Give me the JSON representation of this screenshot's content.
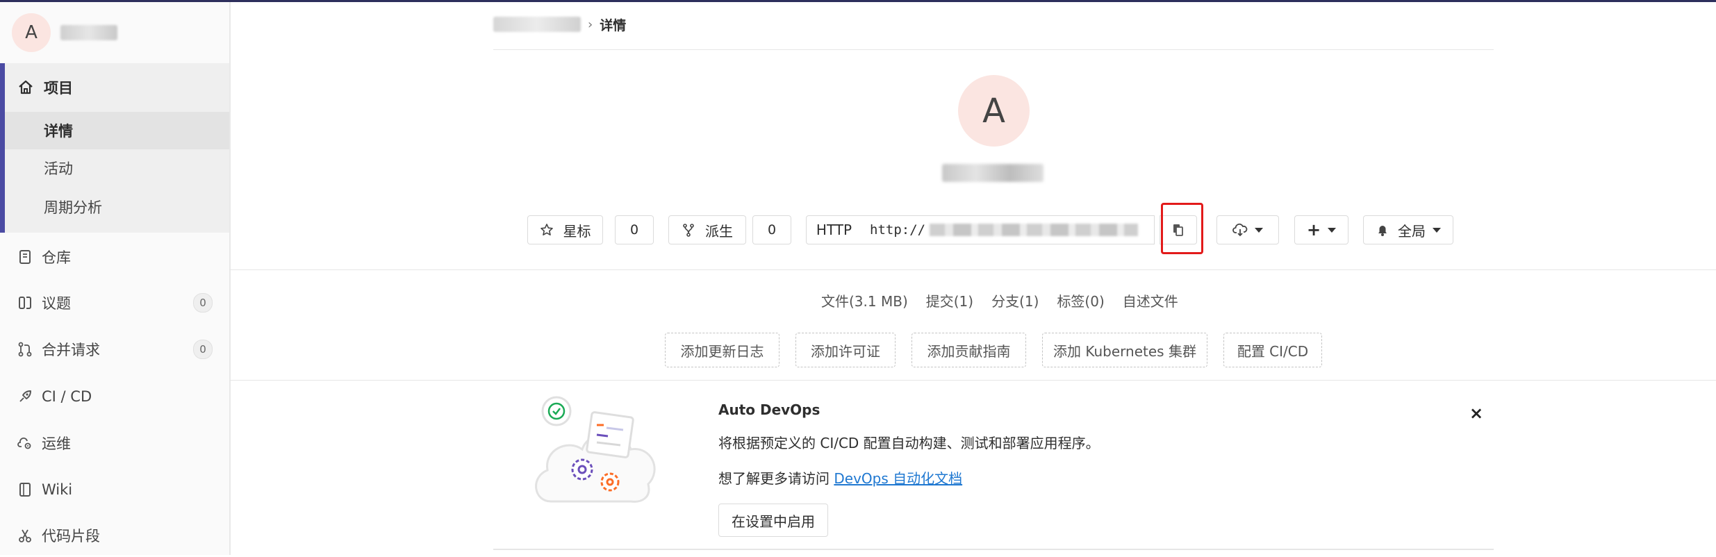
{
  "sidebar": {
    "project_avatar_letter": "A",
    "project_section": {
      "label": "项目",
      "items": [
        {
          "label": "详情",
          "active": true
        },
        {
          "label": "活动"
        },
        {
          "label": "周期分析"
        }
      ]
    },
    "nav": [
      {
        "label": "仓库",
        "icon": "book-icon"
      },
      {
        "label": "议题",
        "icon": "issues-icon",
        "count": "0"
      },
      {
        "label": "合并请求",
        "icon": "merge-request-icon",
        "count": "0"
      },
      {
        "label": "CI / CD",
        "icon": "rocket-icon"
      },
      {
        "label": "运维",
        "icon": "cloud-gear-icon"
      },
      {
        "label": "Wiki",
        "icon": "wiki-book-icon"
      },
      {
        "label": "代码片段",
        "icon": "scissors-icon"
      }
    ]
  },
  "breadcrumb": {
    "current": "详情",
    "separator": "›"
  },
  "project": {
    "avatar_letter": "A"
  },
  "actions": {
    "star_label": "星标",
    "star_count": "0",
    "fork_label": "派生",
    "fork_count": "0",
    "protocol": "HTTP",
    "clone_url_prefix": "http://",
    "notification_label": "全局"
  },
  "stats": [
    "文件(3.1 MB)",
    "提交(1)",
    "分支(1)",
    "标签(0)",
    "自述文件"
  ],
  "quick_actions": [
    "添加更新日志",
    "添加许可证",
    "添加贡献指南",
    "添加 Kubernetes 集群",
    "配置 CI/CD"
  ],
  "auto_devops": {
    "title": "Auto DevOps",
    "description": "将根据预定义的 CI/CD 配置自动构建、测试和部署应用程序。",
    "more_prefix": "想了解更多请访问 ",
    "more_link": "DevOps 自动化文档",
    "enable_button": "在设置中启用",
    "close": "×"
  },
  "colors": {
    "topbar": "#2d2f5c",
    "sidebar_active_border": "#4b4ba3",
    "avatar_bg": "#fbe5e1",
    "highlight_box": "#e21a1a",
    "link": "#1f78d1"
  }
}
